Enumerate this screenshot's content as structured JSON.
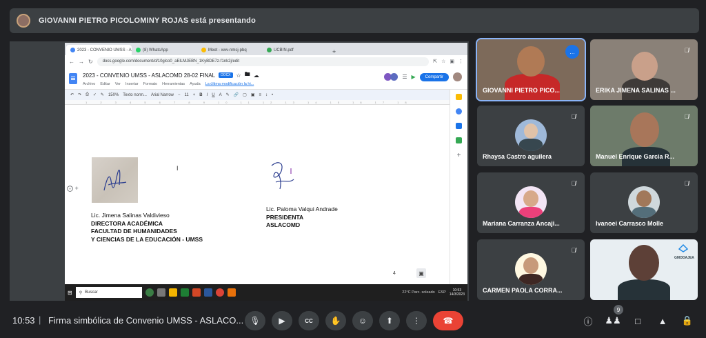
{
  "presenter": {
    "text": "GIOVANNI PIETRO PICOLOMINY ROJAS está presentando"
  },
  "browser": {
    "tabs": [
      {
        "label": "2023 - CONVENIO UMSS - A",
        "color": "#4285f4",
        "active": true
      },
      {
        "label": "(8) WhatsApp",
        "color": "#25d366",
        "active": false
      },
      {
        "label": "Meet - xwv-nmsj-pbq",
        "color": "#fbbc04",
        "active": false
      },
      {
        "label": "UCB!N.pdf",
        "color": "#34a853",
        "active": false
      }
    ],
    "new_tab": "+",
    "url": "docs.google.com/document/d/10glco0_aElLMJEBN_1KyBDE7z-f1nk2j/edit"
  },
  "docs": {
    "title": "2023 - CONVENIO UMSS - ASLACOMD 28-02 FINAL",
    "badge": "DOCX",
    "menu": [
      "Archivo",
      "Editar",
      "Ver",
      "Insertar",
      "Formato",
      "Herramientas",
      "Ayuda"
    ],
    "last_edit": "La última modificación la hi...",
    "share_label": "Compartir",
    "toolbar": {
      "zoom": "150%",
      "style": "Texto norm...",
      "font": "Arial Narrow",
      "size": "11",
      "ruler": "1 2 3 4 5 6 7 8 9 10 11 12 13 14 15 16 17 18"
    },
    "left_signature": {
      "name": "Lic. Jimena Salinas Valdivieso",
      "line1": "DIRECTORA ACADÉMICA",
      "line2": "FACULTAD DE HUMANIDADES",
      "line3": "Y CIENCIAS DE LA EDUCACIÓN - UMSS"
    },
    "right_signature": {
      "name": "Lic. Paloma Valqui Andrade",
      "line1": "PRESIDENTA",
      "line2": "ASLACOMD"
    },
    "page_number": "4"
  },
  "taskbar": {
    "search": "Buscar",
    "weather": "22°C  Parc. soleado",
    "lang": "ESP",
    "time": "10:53",
    "date": "14/3/2023"
  },
  "participants": [
    {
      "name": "GIOVANNI PIETRO PICO...",
      "state": "speaking"
    },
    {
      "name": "ERIKA JIMENA SALINAS ...",
      "state": "muted"
    },
    {
      "name": "Rhaysa Castro aguilera",
      "state": "muted"
    },
    {
      "name": "Manuel Enrique Garcia R...",
      "state": "muted"
    },
    {
      "name": "Mariana Carranza Ancaji...",
      "state": "muted"
    },
    {
      "name": "Ivanoei Carrasco Molle",
      "state": "muted"
    },
    {
      "name": "CARMEN PAOLA CORRA...",
      "state": "muted"
    },
    {
      "name": "",
      "state": "video"
    }
  ],
  "tile_logo_text": "GMODAJEA",
  "meeting": {
    "time": "10:53",
    "separator": "|",
    "title": "Firma simbólica de Convenio UMSS - ASLACO..."
  },
  "controls": {
    "people_count": "9"
  },
  "icons": [
    "mic-icon",
    "camera-icon",
    "captions-icon",
    "raise-hand-icon",
    "emoji-icon",
    "present-icon",
    "more-icon",
    "end-call-icon",
    "info-icon",
    "people-icon",
    "chat-icon",
    "activities-icon",
    "host-controls-icon",
    "mic-off-icon"
  ],
  "colors": {
    "meet_bg": "#202124",
    "tile_bg": "#3c4043",
    "accent": "#1a73e8",
    "end_call": "#ea4335",
    "active_outline": "#8ab4f8"
  }
}
